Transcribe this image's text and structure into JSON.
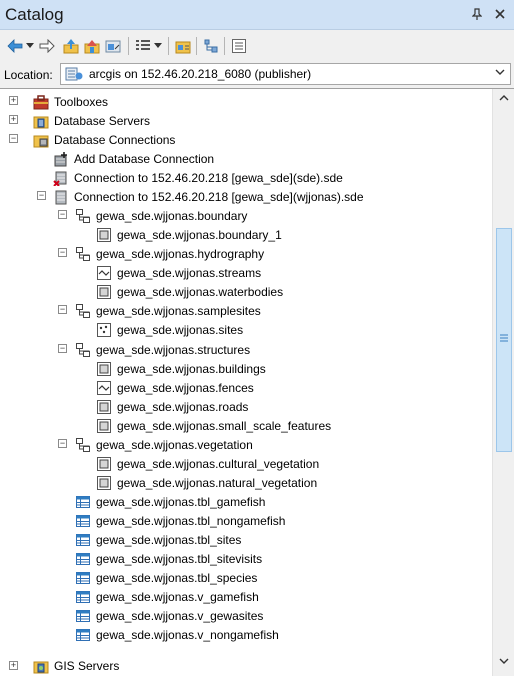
{
  "window": {
    "title": "Catalog",
    "pin_glyph": "ᵖ ᵡ",
    "close_glyph": "x"
  },
  "toolbar": {
    "buttons": [
      {
        "name": "back-icon"
      },
      {
        "name": "back-dropdown-icon"
      },
      {
        "name": "forward-icon"
      },
      {
        "name": "up-one-level-icon"
      },
      {
        "name": "home-folder-icon"
      },
      {
        "name": "connect-folder-icon"
      },
      {
        "name": "view-options-icon"
      },
      {
        "name": "view-dropdown-icon"
      },
      {
        "name": "launch-arccatalog-icon"
      },
      {
        "name": "toggle-contents-panel-icon"
      },
      {
        "name": "options-icon"
      }
    ]
  },
  "location": {
    "label": "Location:",
    "value": "arcgis on 152.46.20.218_6080 (publisher)"
  },
  "tree": {
    "toolboxes": "Toolboxes",
    "database_servers": "Database Servers",
    "database_connections": "Database Connections",
    "add_db_connection": "Add Database Connection",
    "conn_sde": "Connection to 152.46.20.218 [gewa_sde](sde).sde",
    "conn_wjjonas": "Connection to 152.46.20.218 [gewa_sde](wjjonas).sde",
    "boundary_fd": "gewa_sde.wjjonas.boundary",
    "boundary_1": "gewa_sde.wjjonas.boundary_1",
    "hydrography_fd": "gewa_sde.wjjonas.hydrography",
    "streams": "gewa_sde.wjjonas.streams",
    "waterbodies": "gewa_sde.wjjonas.waterbodies",
    "samplesites_fd": "gewa_sde.wjjonas.samplesites",
    "sites": "gewa_sde.wjjonas.sites",
    "structures_fd": "gewa_sde.wjjonas.structures",
    "buildings": "gewa_sde.wjjonas.buildings",
    "fences": "gewa_sde.wjjonas.fences",
    "roads": "gewa_sde.wjjonas.roads",
    "small_scale": "gewa_sde.wjjonas.small_scale_features",
    "vegetation_fd": "gewa_sde.wjjonas.vegetation",
    "cultural_veg": "gewa_sde.wjjonas.cultural_vegetation",
    "natural_veg": "gewa_sde.wjjonas.natural_vegetation",
    "tbl_gamefish": "gewa_sde.wjjonas.tbl_gamefish",
    "tbl_nongamefish": "gewa_sde.wjjonas.tbl_nongamefish",
    "tbl_sites": "gewa_sde.wjjonas.tbl_sites",
    "tbl_sitevisits": "gewa_sde.wjjonas.tbl_sitevisits",
    "tbl_species": "gewa_sde.wjjonas.tbl_species",
    "v_gamefish": "gewa_sde.wjjonas.v_gamefish",
    "v_gewasites": "gewa_sde.wjjonas.v_gewasites",
    "v_nongamefish": "gewa_sde.wjjonas.v_nongamefish",
    "gis_servers": "GIS Servers"
  },
  "colors": {
    "titlebar": "#cfe1f5",
    "scroll_thumb": "#cce4f7",
    "accent": "#2f7dc2"
  }
}
